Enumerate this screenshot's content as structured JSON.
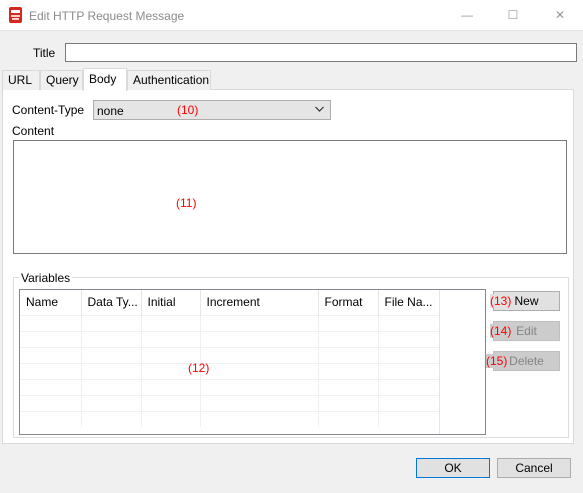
{
  "window": {
    "title": "Edit HTTP Request Message",
    "minimize_glyph": "—",
    "maximize_glyph": "☐",
    "close_glyph": "✕",
    "icon": "app-icon"
  },
  "form": {
    "title_label": "Title",
    "title_value": ""
  },
  "tabs": [
    {
      "label": "URL"
    },
    {
      "label": "Query"
    },
    {
      "label": "Body"
    },
    {
      "label": "Authentication"
    }
  ],
  "body": {
    "content_type_label": "Content-Type",
    "content_type_value": "none",
    "content_label": "Content",
    "content_value": "",
    "variables_label": "Variables"
  },
  "annotations": {
    "a10": "(10)",
    "a11": "(11)",
    "a12": "(12)",
    "a13": "(13)",
    "a14": "(14)",
    "a15": "(15)"
  },
  "variables_table": {
    "columns": [
      "Name",
      "Data Ty...",
      "Initial",
      "Increment",
      "Format",
      "File Na..."
    ],
    "rows": [
      [],
      [],
      [],
      [],
      [],
      [],
      []
    ]
  },
  "variable_buttons": {
    "new_label": "New",
    "edit_label": "Edit",
    "delete_label": "Delete"
  },
  "footer": {
    "ok_label": "OK",
    "cancel_label": "Cancel"
  },
  "colors": {
    "annotation": "#ff0000",
    "focus_border": "#0078d7",
    "icon_red": "#d9261c"
  }
}
